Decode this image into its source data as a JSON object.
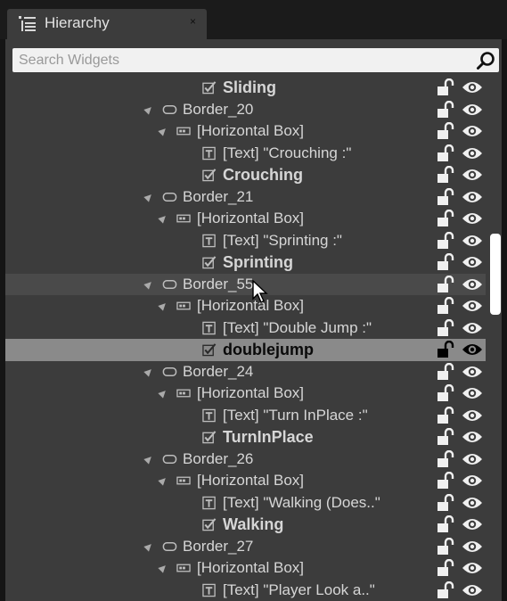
{
  "tab": {
    "title": "Hierarchy",
    "close_glyph": "×",
    "icon": "hierarchy-icon"
  },
  "search": {
    "placeholder": "Search Widgets",
    "value": "",
    "icon": "search-icon"
  },
  "colors": {
    "panel_bg": "#3c3c3c",
    "selected_row_bg": "#8a8a8a",
    "hover_row_bg": "#4a4a4a",
    "scroll_thumb": "#ffffff"
  },
  "tree": {
    "rows": [
      {
        "label": "Sliding",
        "kind": "checkbox",
        "bold": true,
        "expand": false,
        "level": 3,
        "state": ""
      },
      {
        "label": "Border_20",
        "kind": "border",
        "bold": false,
        "expand": true,
        "level": 1,
        "state": ""
      },
      {
        "label": "[Horizontal Box]",
        "kind": "hbox",
        "bold": false,
        "expand": true,
        "level": 2,
        "state": ""
      },
      {
        "label": "[Text] \"Crouching :\"",
        "kind": "text",
        "bold": false,
        "expand": false,
        "level": 3,
        "state": ""
      },
      {
        "label": "Crouching",
        "kind": "checkbox",
        "bold": true,
        "expand": false,
        "level": 3,
        "state": ""
      },
      {
        "label": "Border_21",
        "kind": "border",
        "bold": false,
        "expand": true,
        "level": 1,
        "state": ""
      },
      {
        "label": "[Horizontal Box]",
        "kind": "hbox",
        "bold": false,
        "expand": true,
        "level": 2,
        "state": ""
      },
      {
        "label": "[Text] \"Sprinting :\"",
        "kind": "text",
        "bold": false,
        "expand": false,
        "level": 3,
        "state": ""
      },
      {
        "label": "Sprinting",
        "kind": "checkbox",
        "bold": true,
        "expand": false,
        "level": 3,
        "state": ""
      },
      {
        "label": "Border_55",
        "kind": "border",
        "bold": false,
        "expand": true,
        "level": 1,
        "state": "hover"
      },
      {
        "label": "[Horizontal Box]",
        "kind": "hbox",
        "bold": false,
        "expand": true,
        "level": 2,
        "state": ""
      },
      {
        "label": "[Text] \"Double Jump :\"",
        "kind": "text",
        "bold": false,
        "expand": false,
        "level": 3,
        "state": ""
      },
      {
        "label": "doublejump",
        "kind": "checkbox",
        "bold": true,
        "expand": false,
        "level": 3,
        "state": "selected"
      },
      {
        "label": "Border_24",
        "kind": "border",
        "bold": false,
        "expand": true,
        "level": 1,
        "state": ""
      },
      {
        "label": "[Horizontal Box]",
        "kind": "hbox",
        "bold": false,
        "expand": true,
        "level": 2,
        "state": ""
      },
      {
        "label": "[Text] \"Turn InPlace :\"",
        "kind": "text",
        "bold": false,
        "expand": false,
        "level": 3,
        "state": ""
      },
      {
        "label": "TurnInPlace",
        "kind": "checkbox",
        "bold": true,
        "expand": false,
        "level": 3,
        "state": ""
      },
      {
        "label": "Border_26",
        "kind": "border",
        "bold": false,
        "expand": true,
        "level": 1,
        "state": ""
      },
      {
        "label": "[Horizontal Box]",
        "kind": "hbox",
        "bold": false,
        "expand": true,
        "level": 2,
        "state": ""
      },
      {
        "label": "[Text] \"Walking (Does..\"",
        "kind": "text",
        "bold": false,
        "expand": false,
        "level": 3,
        "state": ""
      },
      {
        "label": "Walking",
        "kind": "checkbox",
        "bold": true,
        "expand": false,
        "level": 3,
        "state": ""
      },
      {
        "label": "Border_27",
        "kind": "border",
        "bold": false,
        "expand": true,
        "level": 1,
        "state": ""
      },
      {
        "label": "[Horizontal Box]",
        "kind": "hbox",
        "bold": false,
        "expand": true,
        "level": 2,
        "state": ""
      },
      {
        "label": "[Text] \"Player Look a..\"",
        "kind": "text",
        "bold": false,
        "expand": false,
        "level": 3,
        "state": ""
      }
    ]
  }
}
